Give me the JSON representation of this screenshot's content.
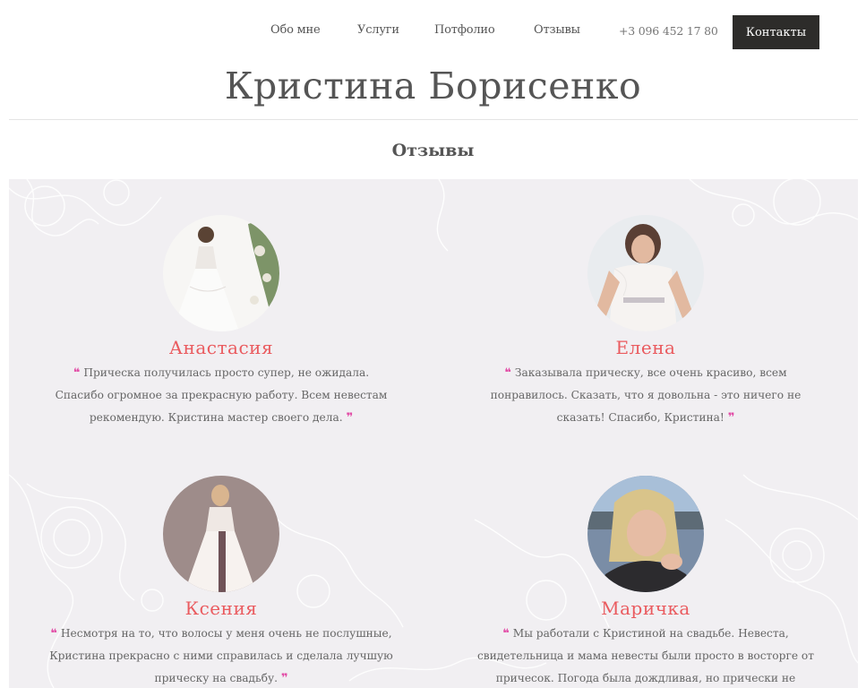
{
  "nav": {
    "items": [
      "Обо мне",
      "Услуги",
      "Потфолио",
      "Отзывы"
    ],
    "phone": "+3 096 452 17 80",
    "contacts": "Контакты"
  },
  "site_title": "Кристина Борисенко",
  "section_title": "Отзывы",
  "colors": {
    "accent_name": "#ea5b5f",
    "quote_mark": "#e24ba6",
    "contacts_bg": "#2d2c2a",
    "panel_bg": "#f1eff2"
  },
  "quote_open": "❝",
  "quote_close": "❞",
  "reviews": [
    {
      "name": "Анастасия",
      "text": "Прическа получилась просто супер, не ожидала. Спасибо огромное за прекрасную работу. Всем невестам рекомендую. Кристина мастер своего дела."
    },
    {
      "name": "Елена",
      "text": "Заказывала прическу, все очень красиво, всем понравилось. Сказать, что я довольна - это ничего не сказать! Спасибо, Кристина!"
    },
    {
      "name": "Ксения",
      "text": "Несмотря на то, что волосы у меня очень не послушные, Кристина прекрасно с ними справилась и сделала лучшую прическу на свадьбу."
    },
    {
      "name": "Маричка",
      "text": "Мы работали с Кристиной на свадьбе. Невеста, свидетельница и мама невесты были просто в восторге от причесок. Погода была дождливая, но прически не"
    }
  ]
}
